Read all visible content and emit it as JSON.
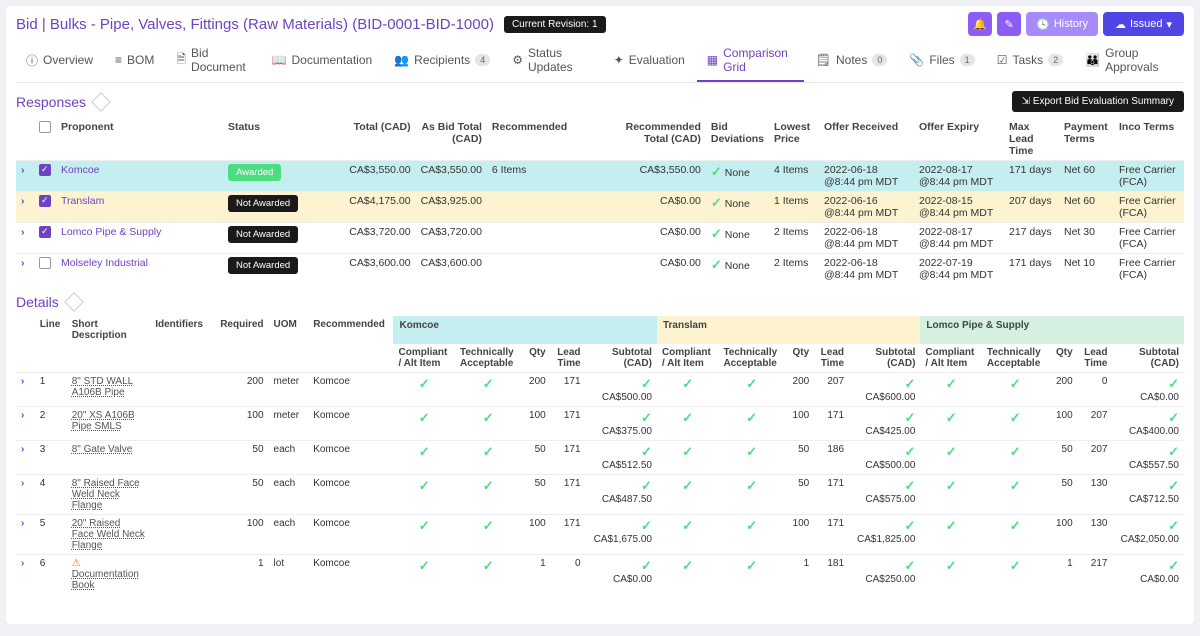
{
  "header": {
    "title": "Bid | Bulks - Pipe, Valves, Fittings (Raw Materials) (BID-0001-BID-1000)",
    "revision": "Current Revision: 1",
    "history": "History",
    "issued": "Issued"
  },
  "tabs": {
    "overview": "Overview",
    "bom": "BOM",
    "bidDoc": "Bid Document",
    "documentation": "Documentation",
    "recipients": "Recipients",
    "recipientsCount": "4",
    "statusUpdates": "Status Updates",
    "evaluation": "Evaluation",
    "comparisonGrid": "Comparison Grid",
    "notes": "Notes",
    "notesCount": "0",
    "files": "Files",
    "filesCount": "1",
    "tasks": "Tasks",
    "tasksCount": "2",
    "groupApprovals": "Group Approvals"
  },
  "responses": {
    "title": "Responses",
    "export": "Export Bid Evaluation Summary",
    "cols": {
      "proponent": "Proponent",
      "status": "Status",
      "total": "Total (CAD)",
      "asBid": "As Bid Total (CAD)",
      "recommended": "Recommended",
      "recTotal": "Recommended Total (CAD)",
      "bidDev": "Bid Deviations",
      "lowest": "Lowest Price",
      "received": "Offer Received",
      "expiry": "Offer Expiry",
      "maxLead": "Max Lead Time",
      "payment": "Payment Terms",
      "inco": "Inco Terms"
    },
    "rows": [
      {
        "checked": true,
        "proponent": "Komcoe",
        "status": "Awarded",
        "total": "CA$3,550.00",
        "asBid": "CA$3,550.00",
        "rec": "6 Items",
        "recTotal": "CA$3,550.00",
        "dev": "None",
        "lowest": "4 Items",
        "received": "2022-06-18 @8:44 pm MDT",
        "expiry": "2022-08-17 @8:44 pm MDT",
        "maxLead": "171 days",
        "pay": "Net 60",
        "inco": "Free Carrier (FCA)"
      },
      {
        "checked": true,
        "proponent": "Translam",
        "status": "Not Awarded",
        "total": "CA$4,175.00",
        "asBid": "CA$3,925.00",
        "rec": "",
        "recTotal": "CA$0.00",
        "dev": "None",
        "lowest": "1 Items",
        "received": "2022-06-16 @8:44 pm MDT",
        "expiry": "2022-08-15 @8:44 pm MDT",
        "maxLead": "207 days",
        "pay": "Net 60",
        "inco": "Free Carrier (FCA)"
      },
      {
        "checked": true,
        "proponent": "Lomco Pipe & Supply",
        "status": "Not Awarded",
        "total": "CA$3,720.00",
        "asBid": "CA$3,720.00",
        "rec": "",
        "recTotal": "CA$0.00",
        "dev": "None",
        "lowest": "2 Items",
        "received": "2022-06-18 @8:44 pm MDT",
        "expiry": "2022-08-17 @8:44 pm MDT",
        "maxLead": "217 days",
        "pay": "Net 30",
        "inco": "Free Carrier (FCA)"
      },
      {
        "checked": false,
        "proponent": "Molseley Industrial",
        "status": "Not Awarded",
        "total": "CA$3,600.00",
        "asBid": "CA$3,600.00",
        "rec": "",
        "recTotal": "CA$0.00",
        "dev": "None",
        "lowest": "2 Items",
        "received": "2022-06-18 @8:44 pm MDT",
        "expiry": "2022-07-19 @8:44 pm MDT",
        "maxLead": "171 days",
        "pay": "Net 10",
        "inco": "Free Carrier (FCA)"
      }
    ]
  },
  "details": {
    "title": "Details",
    "cols": {
      "line": "Line",
      "desc": "Short Description",
      "ident": "Identifiers",
      "req": "Required",
      "uom": "UOM",
      "rec": "Recommended",
      "compliant": "Compliant / Alt Item",
      "tech": "Technically Acceptable",
      "qty": "Qty",
      "lead": "Lead Time",
      "sub": "Subtotal (CAD)"
    },
    "bidders": [
      "Komcoe",
      "Translam",
      "Lomco Pipe & Supply"
    ],
    "rows": [
      {
        "line": "1",
        "desc": "8\" STD WALL A106B Pipe",
        "req": "200",
        "uom": "meter",
        "rec": "Komcoe",
        "b": [
          {
            "qty": "200",
            "lead": "171",
            "sub": "CA$500.00"
          },
          {
            "qty": "200",
            "lead": "207",
            "sub": "CA$600.00"
          },
          {
            "qty": "200",
            "lead": "0",
            "sub": "CA$0.00"
          }
        ]
      },
      {
        "line": "2",
        "desc": "20\" XS A106B Pipe SMLS",
        "req": "100",
        "uom": "meter",
        "rec": "Komcoe",
        "b": [
          {
            "qty": "100",
            "lead": "171",
            "sub": "CA$375.00"
          },
          {
            "qty": "100",
            "lead": "171",
            "sub": "CA$425.00"
          },
          {
            "qty": "100",
            "lead": "207",
            "sub": "CA$400.00"
          }
        ]
      },
      {
        "line": "3",
        "desc": "8\" Gate Valve",
        "req": "50",
        "uom": "each",
        "rec": "Komcoe",
        "b": [
          {
            "qty": "50",
            "lead": "171",
            "sub": "CA$512.50"
          },
          {
            "qty": "50",
            "lead": "186",
            "sub": "CA$500.00"
          },
          {
            "qty": "50",
            "lead": "207",
            "sub": "CA$557.50"
          }
        ]
      },
      {
        "line": "4",
        "desc": "8\" Raised Face Weld Neck Flange",
        "req": "50",
        "uom": "each",
        "rec": "Komcoe",
        "b": [
          {
            "qty": "50",
            "lead": "171",
            "sub": "CA$487.50"
          },
          {
            "qty": "50",
            "lead": "171",
            "sub": "CA$575.00"
          },
          {
            "qty": "50",
            "lead": "130",
            "sub": "CA$712.50"
          }
        ]
      },
      {
        "line": "5",
        "desc": "20\" Raised Face Weld Neck Flange",
        "req": "100",
        "uom": "each",
        "rec": "Komcoe",
        "b": [
          {
            "qty": "100",
            "lead": "171",
            "sub": "CA$1,675.00"
          },
          {
            "qty": "100",
            "lead": "171",
            "sub": "CA$1,825.00"
          },
          {
            "qty": "100",
            "lead": "130",
            "sub": "CA$2,050.00"
          }
        ]
      },
      {
        "line": "6",
        "desc": "Documentation Book",
        "warn": true,
        "req": "1",
        "uom": "lot",
        "rec": "Komcoe",
        "b": [
          {
            "qty": "1",
            "lead": "0",
            "sub": "CA$0.00"
          },
          {
            "qty": "1",
            "lead": "181",
            "sub": "CA$250.00"
          },
          {
            "qty": "1",
            "lead": "217",
            "sub": "CA$0.00"
          }
        ]
      }
    ]
  }
}
